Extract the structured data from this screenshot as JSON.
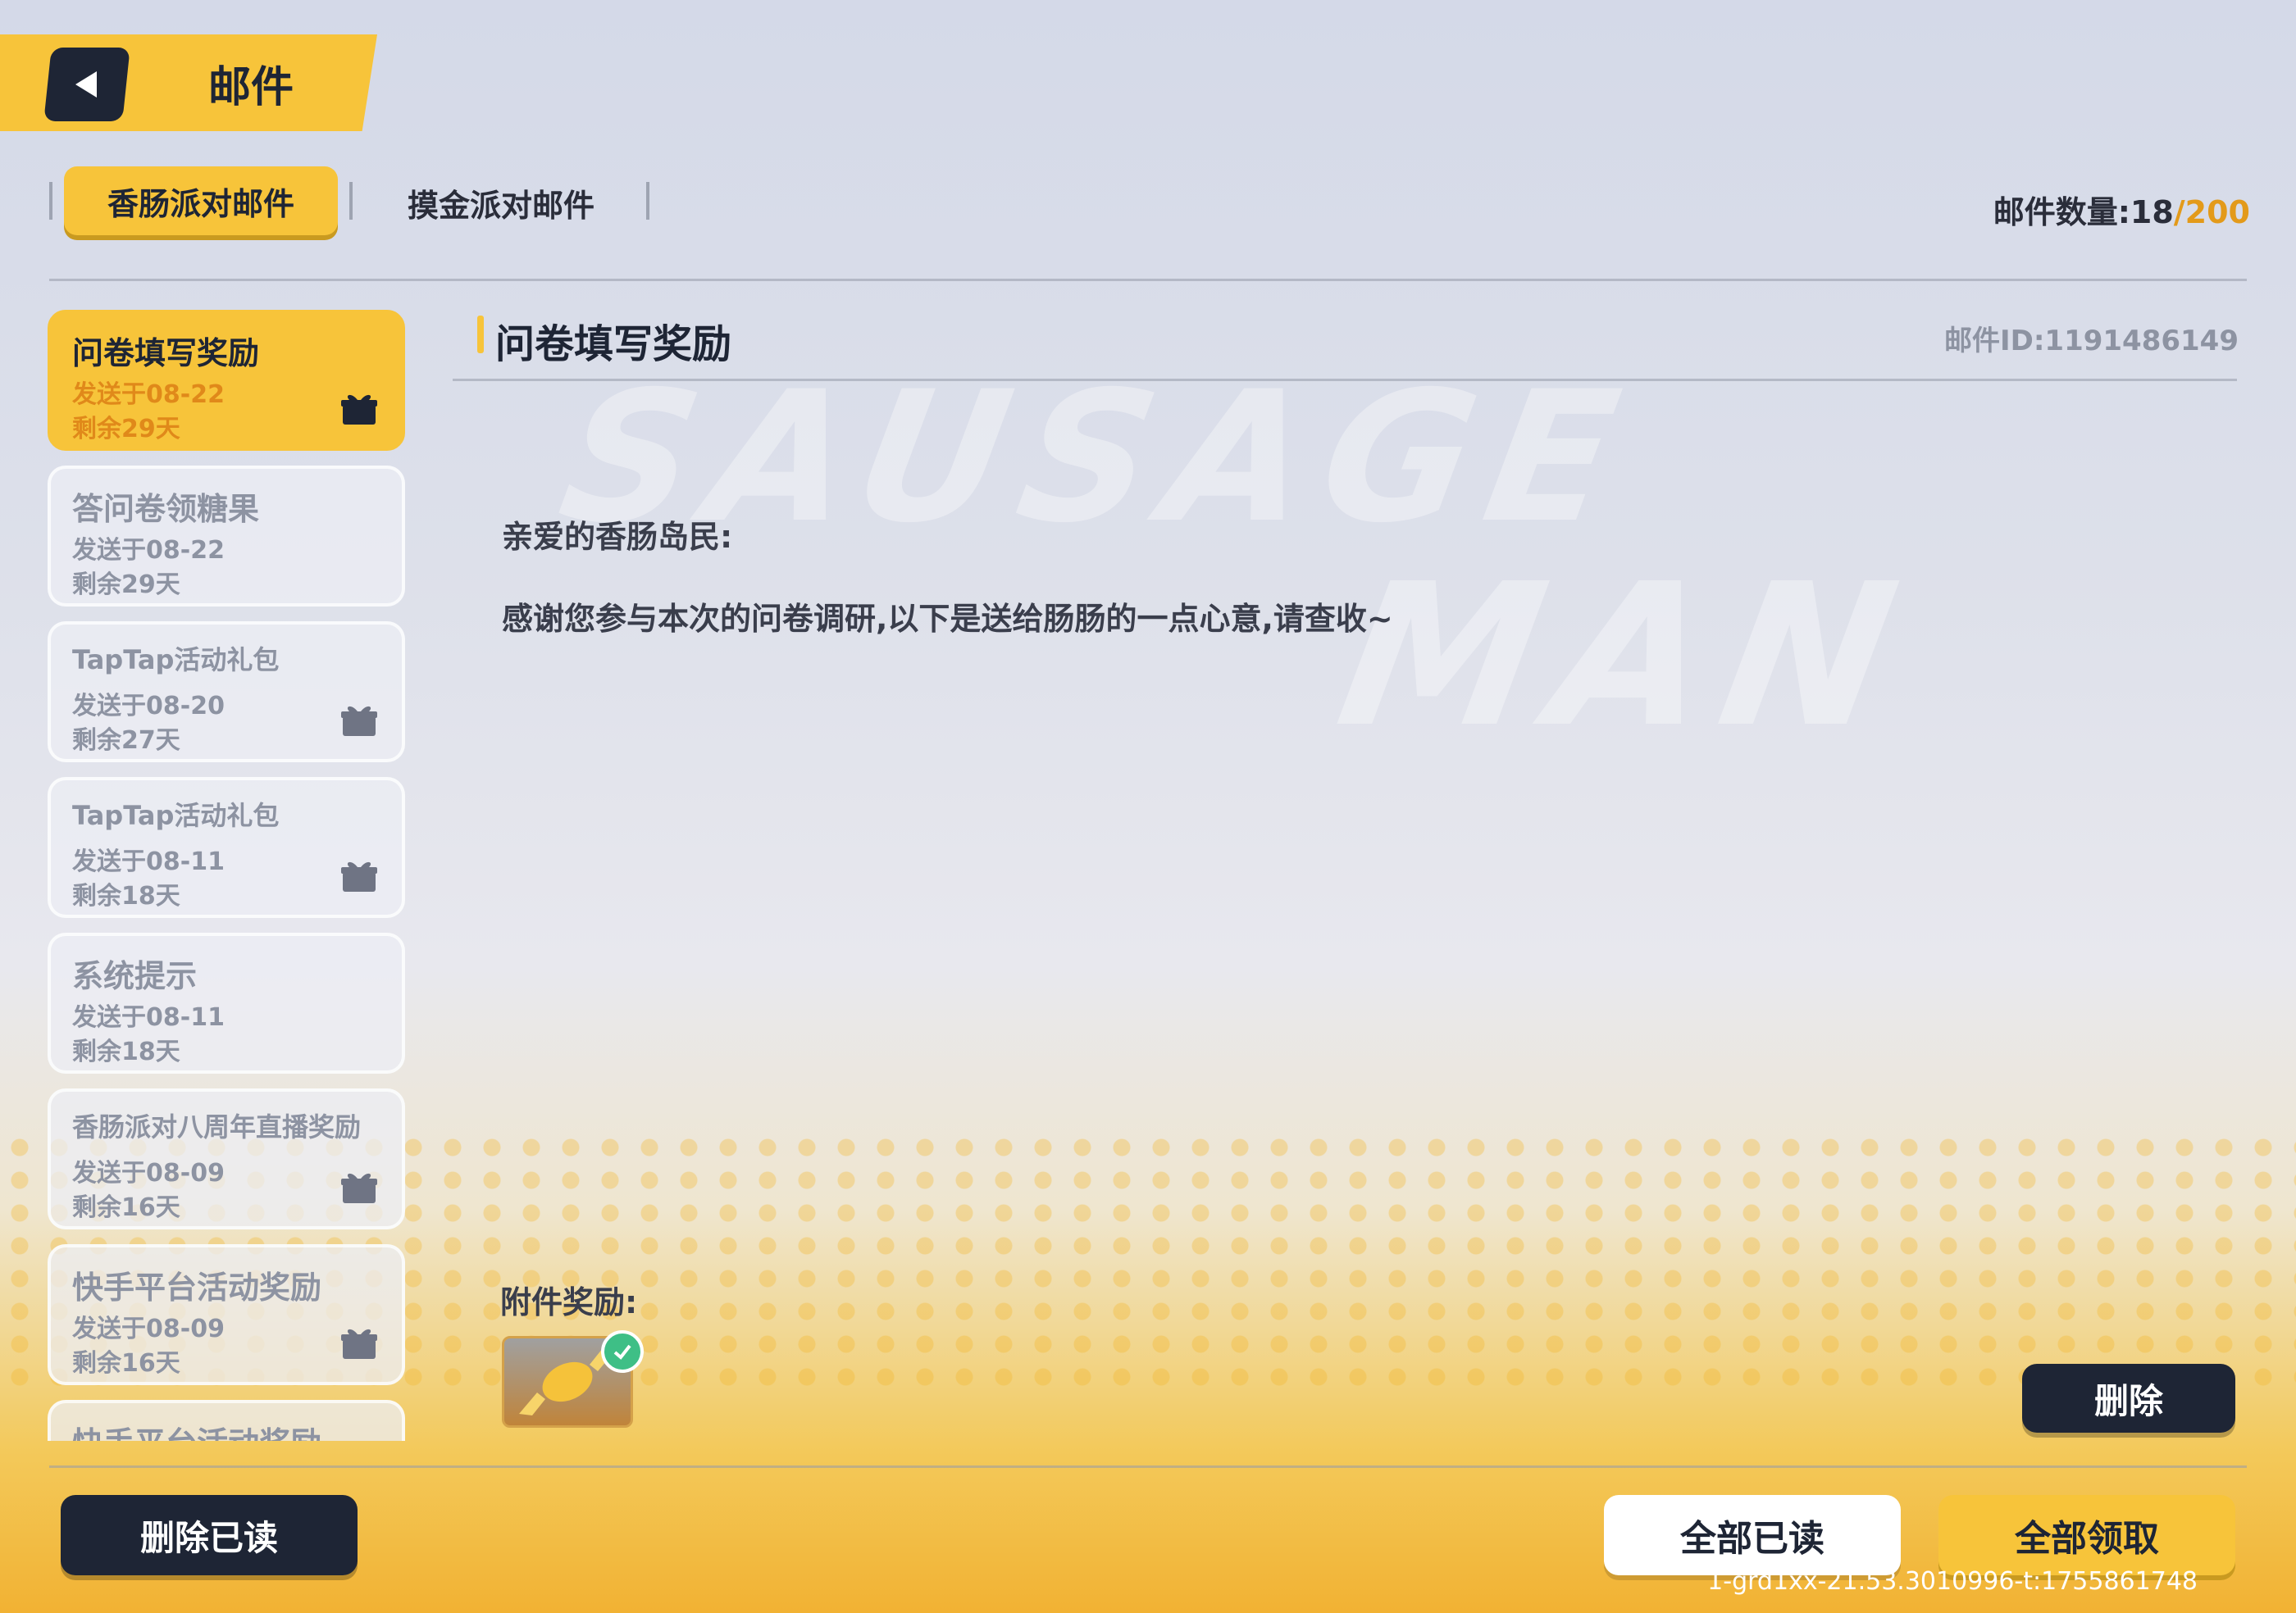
{
  "header": {
    "title": "邮件",
    "back_icon": "back-arrow-icon"
  },
  "tabs": [
    {
      "label": "香肠派对邮件",
      "active": true
    },
    {
      "label": "摸金派对邮件",
      "active": false
    }
  ],
  "mail_count": {
    "label": "邮件数量:",
    "current": "18",
    "separator": "/",
    "max": "200"
  },
  "watermark": {
    "line1": "SAUSAGE",
    "line2": "MAN"
  },
  "mail_list": [
    {
      "title": "问卷填写奖励",
      "sent": "发送于08-22",
      "remaining": "剩余29天",
      "has_gift": true,
      "active": true
    },
    {
      "title": "答问卷领糖果",
      "sent": "发送于08-22",
      "remaining": "剩余29天",
      "has_gift": false,
      "active": false
    },
    {
      "title": "TapTap活动礼包",
      "sent": "发送于08-20",
      "remaining": "剩余27天",
      "has_gift": true,
      "active": false
    },
    {
      "title": "TapTap活动礼包",
      "sent": "发送于08-11",
      "remaining": "剩余18天",
      "has_gift": true,
      "active": false
    },
    {
      "title": "系统提示",
      "sent": "发送于08-11",
      "remaining": "剩余18天",
      "has_gift": false,
      "active": false
    },
    {
      "title": "香肠派对八周年直播奖励",
      "sent": "发送于08-09",
      "remaining": "剩余16天",
      "has_gift": true,
      "active": false
    },
    {
      "title": "快手平台活动奖励",
      "sent": "发送于08-09",
      "remaining": "剩余16天",
      "has_gift": true,
      "active": false
    },
    {
      "title": "快手平台活动奖励",
      "sent": "",
      "remaining": "",
      "has_gift": false,
      "active": false
    }
  ],
  "detail": {
    "title": "问卷填写奖励",
    "mail_id": "邮件ID:1191486149",
    "greeting": "亲爱的香肠岛民:",
    "body": "感谢您参与本次的问卷调研,以下是送给肠肠的一点心意,请查收~",
    "attachment_label": "附件奖励:",
    "attachment_icon": "candy-icon",
    "attachment_claimed": true
  },
  "buttons": {
    "delete": "删除",
    "delete_read": "删除已读",
    "mark_all_read": "全部已读",
    "claim_all": "全部领取"
  },
  "version": "1-grd1xx-21.53.3010996-t:1755861748",
  "colors": {
    "accent": "#f7c43a",
    "dark": "#1e2535",
    "count_max": "#e39a1a",
    "check": "#3ebf86"
  }
}
